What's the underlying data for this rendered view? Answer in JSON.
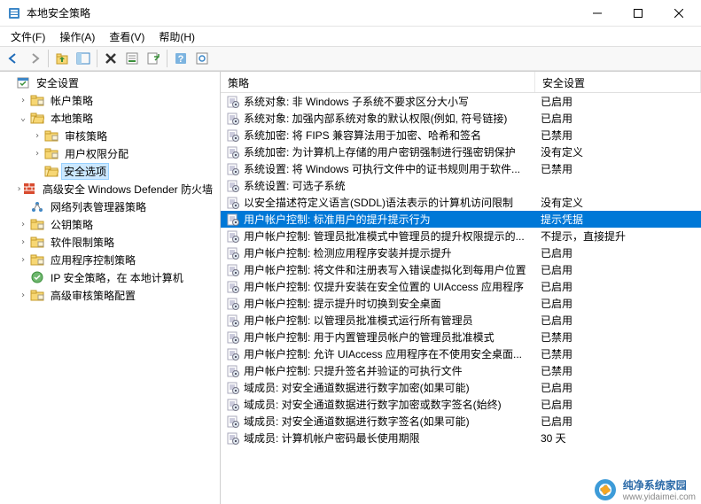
{
  "window": {
    "title": "本地安全策略"
  },
  "menu": {
    "file": "文件(F)",
    "action": "操作(A)",
    "view": "查看(V)",
    "help": "帮助(H)"
  },
  "tree": {
    "root": "安全设置",
    "items": [
      {
        "label": "帐户策略",
        "level": 1,
        "expander": "›",
        "icon": "folder"
      },
      {
        "label": "本地策略",
        "level": 1,
        "expander": "⌄",
        "icon": "folder-open"
      },
      {
        "label": "审核策略",
        "level": 2,
        "expander": "›",
        "icon": "folder"
      },
      {
        "label": "用户权限分配",
        "level": 2,
        "expander": "›",
        "icon": "folder"
      },
      {
        "label": "安全选项",
        "level": 2,
        "expander": "",
        "icon": "folder-open",
        "selected": true
      },
      {
        "label": "高级安全 Windows Defender 防火墙",
        "level": 1,
        "expander": "›",
        "icon": "firewall"
      },
      {
        "label": "网络列表管理器策略",
        "level": 1,
        "expander": "",
        "icon": "network"
      },
      {
        "label": "公钥策略",
        "level": 1,
        "expander": "›",
        "icon": "folder"
      },
      {
        "label": "软件限制策略",
        "level": 1,
        "expander": "›",
        "icon": "folder"
      },
      {
        "label": "应用程序控制策略",
        "level": 1,
        "expander": "›",
        "icon": "folder"
      },
      {
        "label": "IP 安全策略，在 本地计算机",
        "level": 1,
        "expander": "",
        "icon": "ipsec"
      },
      {
        "label": "高级审核策略配置",
        "level": 1,
        "expander": "›",
        "icon": "folder"
      }
    ]
  },
  "list": {
    "headers": {
      "policy": "策略",
      "setting": "安全设置"
    },
    "rows": [
      {
        "policy": "系统对象: 非 Windows 子系统不要求区分大小写",
        "setting": "已启用"
      },
      {
        "policy": "系统对象: 加强内部系统对象的默认权限(例如, 符号链接)",
        "setting": "已启用"
      },
      {
        "policy": "系统加密: 将 FIPS 兼容算法用于加密、哈希和签名",
        "setting": "已禁用"
      },
      {
        "policy": "系统加密: 为计算机上存储的用户密钥强制进行强密钥保护",
        "setting": "没有定义"
      },
      {
        "policy": "系统设置: 将 Windows 可执行文件中的证书规则用于软件...",
        "setting": "已禁用"
      },
      {
        "policy": "系统设置: 可选子系统",
        "setting": ""
      },
      {
        "policy": "以安全描述符定义语言(SDDL)语法表示的计算机访问限制",
        "setting": "没有定义"
      },
      {
        "policy": "用户帐户控制: 标准用户的提升提示行为",
        "setting": "提示凭据",
        "selected": true
      },
      {
        "policy": "用户帐户控制: 管理员批准模式中管理员的提升权限提示的...",
        "setting": "不提示，直接提升"
      },
      {
        "policy": "用户帐户控制: 检测应用程序安装并提示提升",
        "setting": "已启用"
      },
      {
        "policy": "用户帐户控制: 将文件和注册表写入错误虚拟化到每用户位置",
        "setting": "已启用"
      },
      {
        "policy": "用户帐户控制: 仅提升安装在安全位置的 UIAccess 应用程序",
        "setting": "已启用"
      },
      {
        "policy": "用户帐户控制: 提示提升时切换到安全桌面",
        "setting": "已启用"
      },
      {
        "policy": "用户帐户控制: 以管理员批准模式运行所有管理员",
        "setting": "已启用"
      },
      {
        "policy": "用户帐户控制: 用于内置管理员帐户的管理员批准模式",
        "setting": "已禁用"
      },
      {
        "policy": "用户帐户控制: 允许 UIAccess 应用程序在不使用安全桌面...",
        "setting": "已禁用"
      },
      {
        "policy": "用户帐户控制: 只提升签名并验证的可执行文件",
        "setting": "已禁用"
      },
      {
        "policy": "域成员: 对安全通道数据进行数字加密(如果可能)",
        "setting": "已启用"
      },
      {
        "policy": "域成员: 对安全通道数据进行数字加密或数字签名(始终)",
        "setting": "已启用"
      },
      {
        "policy": "域成员: 对安全通道数据进行数字签名(如果可能)",
        "setting": "已启用"
      },
      {
        "policy": "域成员: 计算机帐户密码最长使用期限",
        "setting": "30 天"
      }
    ]
  },
  "watermark": {
    "text": "纯净系统家园",
    "url": "www.yidaimei.com"
  }
}
